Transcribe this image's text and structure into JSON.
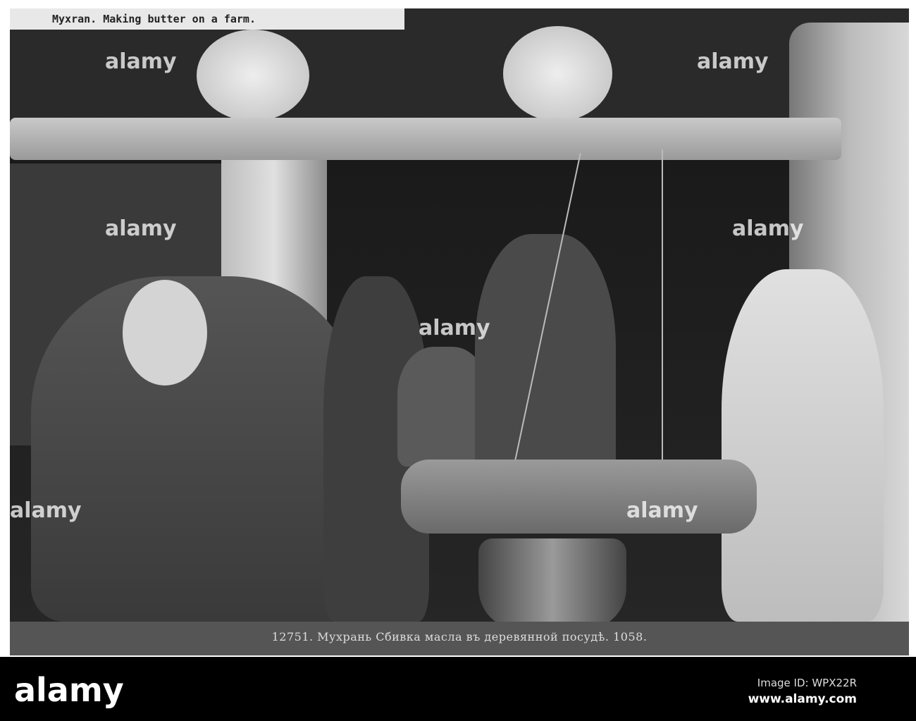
{
  "photo": {
    "top_caption": "Myxran.  Making butter on a farm.",
    "bottom_caption": "12751. Мухрань  Сбивка масла въ деревянной посудѣ. 1058."
  },
  "watermark": {
    "text": "alamy"
  },
  "footer": {
    "logo": "alamy",
    "image_id": "Image ID: WPX22R",
    "url": "www.alamy.com"
  }
}
